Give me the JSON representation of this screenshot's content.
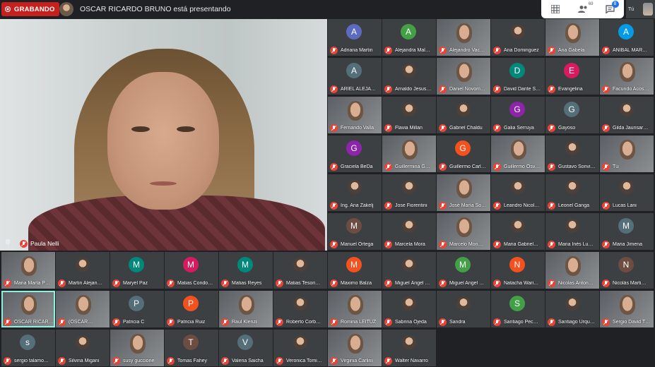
{
  "topbar": {
    "recording_label": "GRABANDO",
    "presenting_text": "OSCAR RICARDO BRUNO está presentando",
    "people_count": "69",
    "chat_badge": "8",
    "self_label": "Tú"
  },
  "main": {
    "speaker_name": "Paula Nelli"
  },
  "colors": {
    "recording": "#c5221f",
    "muted": "#ea4335",
    "tile_bg": "#3c4043",
    "page_bg": "#202124",
    "selected_outline": "#8ef0de"
  },
  "participants": [
    {
      "name": "Adriana Martin",
      "initial": "A",
      "color": "#5c6bc0",
      "kind": "initial"
    },
    {
      "name": "Alejandra Mal…",
      "initial": "A",
      "color": "#43a047",
      "kind": "initial"
    },
    {
      "name": "Alejandro Vac…",
      "initial": "",
      "color": "",
      "kind": "video"
    },
    {
      "name": "Ana Dominguez",
      "initial": "",
      "color": "",
      "kind": "thumb"
    },
    {
      "name": "Ana Gabela",
      "initial": "",
      "color": "",
      "kind": "video"
    },
    {
      "name": "ANIBAL MAR…",
      "initial": "A",
      "color": "#039be5",
      "kind": "initial"
    },
    {
      "name": "ARIEL ALEJA…",
      "initial": "A",
      "color": "#546e7a",
      "kind": "initial"
    },
    {
      "name": "Arnaldo Jesus…",
      "initial": "",
      "color": "",
      "kind": "thumb"
    },
    {
      "name": "Daniel Novom…",
      "initial": "",
      "color": "",
      "kind": "video"
    },
    {
      "name": "David Dante S…",
      "initial": "D",
      "color": "#00897b",
      "kind": "initial"
    },
    {
      "name": "Evangelina",
      "initial": "E",
      "color": "#d81b60",
      "kind": "initial"
    },
    {
      "name": "Facundo Acos…",
      "initial": "",
      "color": "",
      "kind": "video"
    },
    {
      "name": "Fernando Valla",
      "initial": "",
      "color": "",
      "kind": "video"
    },
    {
      "name": "Flavia Millan",
      "initial": "",
      "color": "",
      "kind": "thumb"
    },
    {
      "name": "Gabriel Chaldu",
      "initial": "",
      "color": "",
      "kind": "thumb"
    },
    {
      "name": "Galia Serruya",
      "initial": "G",
      "color": "#8e24aa",
      "kind": "initial"
    },
    {
      "name": "Gayoso",
      "initial": "G",
      "color": "#546e7a",
      "kind": "initial"
    },
    {
      "name": "Gilda Jaunsar…",
      "initial": "",
      "color": "",
      "kind": "thumb"
    },
    {
      "name": "Graciela BeDa",
      "initial": "G",
      "color": "#8e24aa",
      "kind": "initial"
    },
    {
      "name": "Guillermina G…",
      "initial": "",
      "color": "",
      "kind": "video"
    },
    {
      "name": "Guillermo Carl…",
      "initial": "G",
      "color": "#f4511e",
      "kind": "initial"
    },
    {
      "name": "Guillermo Osv…",
      "initial": "",
      "color": "",
      "kind": "video"
    },
    {
      "name": "Gustavo Sonvi…",
      "initial": "",
      "color": "",
      "kind": "thumb"
    },
    {
      "name": "Tú",
      "initial": "",
      "color": "",
      "kind": "video"
    },
    {
      "name": "Ing. Ana Zakelj",
      "initial": "",
      "color": "",
      "kind": "thumb"
    },
    {
      "name": "Jose Fiorentini",
      "initial": "",
      "color": "",
      "kind": "thumb"
    },
    {
      "name": "José María So…",
      "initial": "",
      "color": "",
      "kind": "video"
    },
    {
      "name": "Leandro Nicol…",
      "initial": "",
      "color": "",
      "kind": "thumb"
    },
    {
      "name": "Leonel Ganga",
      "initial": "",
      "color": "",
      "kind": "thumb"
    },
    {
      "name": "Lucas Lani",
      "initial": "",
      "color": "",
      "kind": "thumb"
    },
    {
      "name": "Manuel Ortega",
      "initial": "M",
      "color": "#6d4c41",
      "kind": "initial"
    },
    {
      "name": "Marcela Mora",
      "initial": "",
      "color": "",
      "kind": "thumb"
    },
    {
      "name": "Marcelo Mon…",
      "initial": "",
      "color": "",
      "kind": "video"
    },
    {
      "name": "Maria Gabriel…",
      "initial": "",
      "color": "",
      "kind": "thumb"
    },
    {
      "name": "Maria Inés Lu…",
      "initial": "",
      "color": "",
      "kind": "thumb"
    },
    {
      "name": "Maria Jimena",
      "initial": "M",
      "color": "#546e7a",
      "kind": "initial"
    },
    {
      "name": "Maria Marta P…",
      "initial": "",
      "color": "",
      "kind": "video"
    },
    {
      "name": "Martin Alejan…",
      "initial": "",
      "color": "",
      "kind": "thumb"
    },
    {
      "name": "Maryel Paz",
      "initial": "M",
      "color": "#00897b",
      "kind": "initial"
    },
    {
      "name": "Matias Condo…",
      "initial": "M",
      "color": "#d81b60",
      "kind": "initial"
    },
    {
      "name": "Matias Reyes",
      "initial": "M",
      "color": "#00897b",
      "kind": "initial"
    },
    {
      "name": "Matias Tesori…",
      "initial": "",
      "color": "",
      "kind": "thumb"
    },
    {
      "name": "Maximo Balza",
      "initial": "M",
      "color": "#f4511e",
      "kind": "initial"
    },
    {
      "name": "Miguel Ángel …",
      "initial": "",
      "color": "",
      "kind": "thumb"
    },
    {
      "name": "Miguel Angel …",
      "initial": "M",
      "color": "#43a047",
      "kind": "initial"
    },
    {
      "name": "Natacha Wari…",
      "initial": "N",
      "color": "#f4511e",
      "kind": "initial"
    },
    {
      "name": "Nicolas Anton…",
      "initial": "",
      "color": "",
      "kind": "video"
    },
    {
      "name": "Nicolás Marti…",
      "initial": "N",
      "color": "#6d4c41",
      "kind": "initial"
    },
    {
      "name": "OSCAR RICAR…",
      "initial": "",
      "color": "",
      "kind": "video"
    },
    {
      "name": "(OSCAR…",
      "initial": "",
      "color": "",
      "kind": "video"
    },
    {
      "name": "Patricia C",
      "initial": "P",
      "color": "#546e7a",
      "kind": "initial"
    },
    {
      "name": "Patricia Ruiz",
      "initial": "P",
      "color": "#f4511e",
      "kind": "initial"
    },
    {
      "name": "Raul Klenzi",
      "initial": "",
      "color": "",
      "kind": "video"
    },
    {
      "name": "Roberto Corb…",
      "initial": "",
      "color": "",
      "kind": "thumb"
    },
    {
      "name": "Romina LEITUZ",
      "initial": "",
      "color": "",
      "kind": "video"
    },
    {
      "name": "Sabrina Ojeda",
      "initial": "",
      "color": "",
      "kind": "thumb"
    },
    {
      "name": "Sandra",
      "initial": "",
      "color": "",
      "kind": "thumb"
    },
    {
      "name": "Santiago Pec…",
      "initial": "S",
      "color": "#43a047",
      "kind": "initial"
    },
    {
      "name": "Santiago Urqu…",
      "initial": "",
      "color": "",
      "kind": "thumb"
    },
    {
      "name": "Sergio David T…",
      "initial": "",
      "color": "",
      "kind": "video"
    },
    {
      "name": "sergio talamo…",
      "initial": "s",
      "color": "#546e7a",
      "kind": "initial"
    },
    {
      "name": "Silvina Migani",
      "initial": "",
      "color": "",
      "kind": "thumb"
    },
    {
      "name": "susy guccione",
      "initial": "",
      "color": "",
      "kind": "video"
    },
    {
      "name": "Tomas Fahey",
      "initial": "T",
      "color": "#6d4c41",
      "kind": "initial"
    },
    {
      "name": "Valeria Saicha",
      "initial": "V",
      "color": "#546e7a",
      "kind": "initial"
    },
    {
      "name": "Veronica Tomi…",
      "initial": "",
      "color": "",
      "kind": "thumb"
    },
    {
      "name": "Virginia Carlini",
      "initial": "",
      "color": "",
      "kind": "video"
    },
    {
      "name": "Walter Navarro",
      "initial": "",
      "color": "",
      "kind": "thumb"
    }
  ]
}
